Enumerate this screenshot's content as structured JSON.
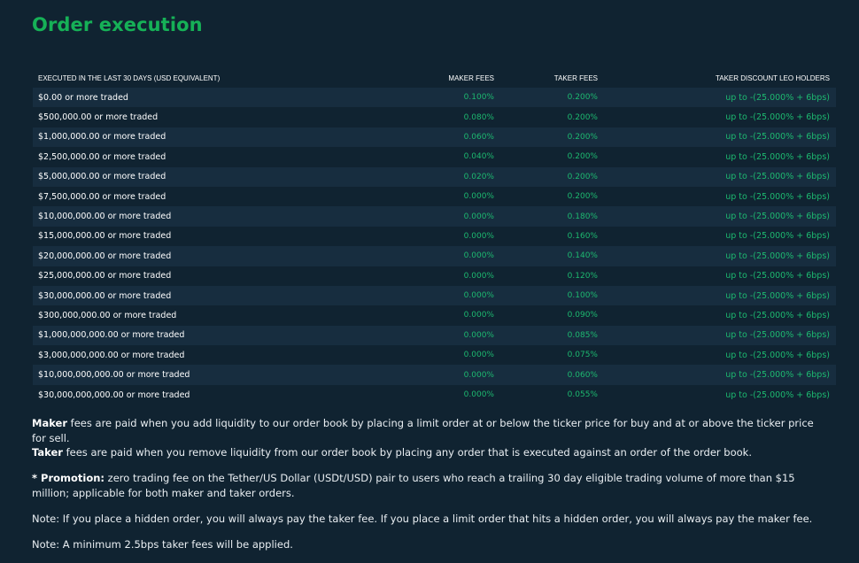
{
  "page": {
    "title": "Order execution"
  },
  "table": {
    "headers": {
      "volume": "EXECUTED IN THE LAST 30 DAYS (USD EQUIVALENT)",
      "maker": "MAKER FEES",
      "taker": "TAKER FEES",
      "discount": "TAKER DISCOUNT LEO HOLDERS"
    },
    "rows": [
      {
        "volume": "$0.00 or more traded",
        "maker": "0.100%",
        "taker": "0.200%",
        "discount": "up to -(25.000% + 6bps)"
      },
      {
        "volume": "$500,000.00 or more traded",
        "maker": "0.080%",
        "taker": "0.200%",
        "discount": "up to -(25.000% + 6bps)"
      },
      {
        "volume": "$1,000,000.00 or more traded",
        "maker": "0.060%",
        "taker": "0.200%",
        "discount": "up to -(25.000% + 6bps)"
      },
      {
        "volume": "$2,500,000.00 or more traded",
        "maker": "0.040%",
        "taker": "0.200%",
        "discount": "up to -(25.000% + 6bps)"
      },
      {
        "volume": "$5,000,000.00 or more traded",
        "maker": "0.020%",
        "taker": "0.200%",
        "discount": "up to -(25.000% + 6bps)"
      },
      {
        "volume": "$7,500,000.00 or more traded",
        "maker": "0.000%",
        "taker": "0.200%",
        "discount": "up to -(25.000% + 6bps)"
      },
      {
        "volume": "$10,000,000.00 or more traded",
        "maker": "0.000%",
        "taker": "0.180%",
        "discount": "up to -(25.000% + 6bps)"
      },
      {
        "volume": "$15,000,000.00 or more traded",
        "maker": "0.000%",
        "taker": "0.160%",
        "discount": "up to -(25.000% + 6bps)"
      },
      {
        "volume": "$20,000,000.00 or more traded",
        "maker": "0.000%",
        "taker": "0.140%",
        "discount": "up to -(25.000% + 6bps)"
      },
      {
        "volume": "$25,000,000.00 or more traded",
        "maker": "0.000%",
        "taker": "0.120%",
        "discount": "up to -(25.000% + 6bps)"
      },
      {
        "volume": "$30,000,000.00 or more traded",
        "maker": "0.000%",
        "taker": "0.100%",
        "discount": "up to -(25.000% + 6bps)"
      },
      {
        "volume": "$300,000,000.00 or more traded",
        "maker": "0.000%",
        "taker": "0.090%",
        "discount": "up to -(25.000% + 6bps)"
      },
      {
        "volume": "$1,000,000,000.00 or more traded",
        "maker": "0.000%",
        "taker": "0.085%",
        "discount": "up to -(25.000% + 6bps)"
      },
      {
        "volume": "$3,000,000,000.00 or more traded",
        "maker": "0.000%",
        "taker": "0.075%",
        "discount": "up to -(25.000% + 6bps)"
      },
      {
        "volume": "$10,000,000,000.00 or more traded",
        "maker": "0.000%",
        "taker": "0.060%",
        "discount": "up to -(25.000% + 6bps)"
      },
      {
        "volume": "$30,000,000,000.00 or more traded",
        "maker": "0.000%",
        "taker": "0.055%",
        "discount": "up to -(25.000% + 6bps)"
      }
    ]
  },
  "notes": {
    "maker_label": "Maker",
    "maker_text": " fees are paid when you add liquidity to our order book by placing a limit order at or below the ticker price for buy and at or above the ticker price for sell.",
    "taker_label": "Taker",
    "taker_text": " fees are paid when you remove liquidity from our order book by placing any order that is executed against an order of the order book.",
    "promotion_label": "* Promotion:",
    "promotion_text": " zero trading fee on the Tether/US Dollar (USDt/USD) pair to users who reach a trailing 30 day eligible trading volume of more than $15 million; applicable for both maker and taker orders.",
    "hidden_order_note": "Note: If you place a hidden order, you will always pay the taker fee. If you place a limit order that hits a hidden order, you will always pay the maker fee.",
    "minimum_fee_note": "Note: A minimum 2.5bps taker fees will be applied."
  },
  "colors": {
    "background": "#102331",
    "stripe": "#172d3f",
    "title": "#16b157",
    "value": "#1db970"
  }
}
